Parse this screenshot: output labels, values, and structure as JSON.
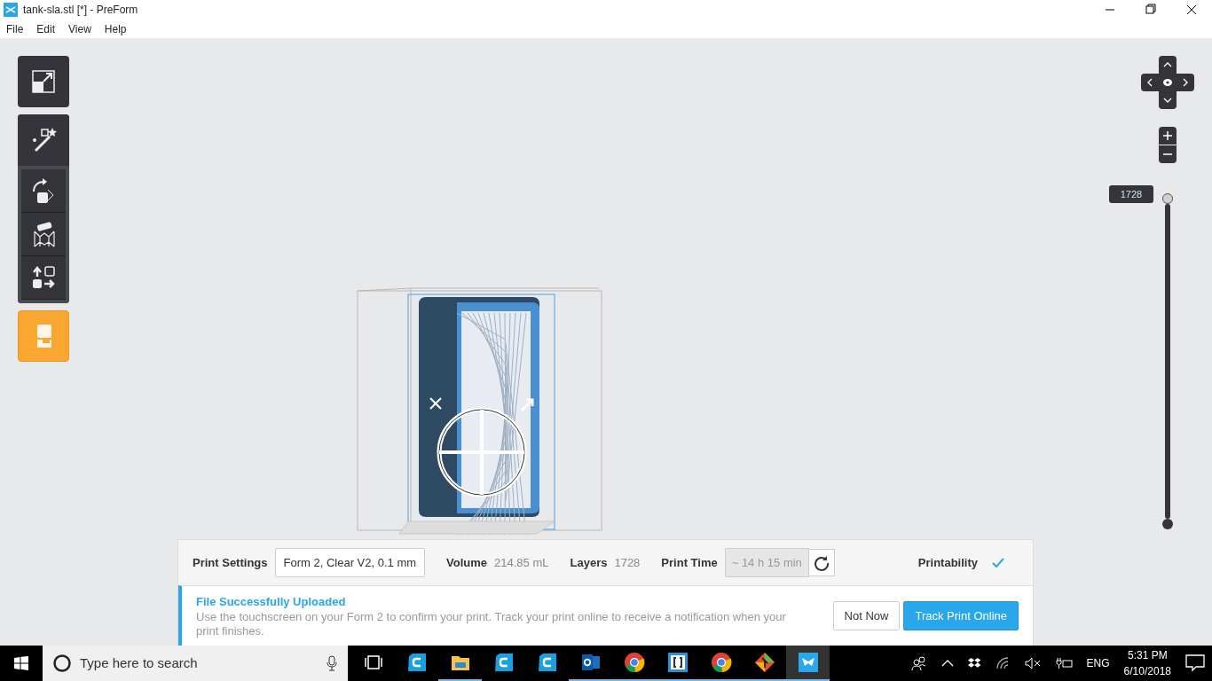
{
  "window": {
    "title": "tank-sla.stl [*] - PreForm"
  },
  "menu": [
    "File",
    "Edit",
    "View",
    "Help"
  ],
  "tool_groups": [
    {
      "tools": [
        {
          "kind": "fit",
          "selected": false
        }
      ]
    },
    {
      "tools": [
        {
          "kind": "wand",
          "selected": false
        }
      ],
      "subtools": [
        {
          "kind": "orient",
          "selected": false
        },
        {
          "kind": "supports",
          "selected": false
        },
        {
          "kind": "layout",
          "selected": false
        }
      ]
    },
    {
      "tools": [
        {
          "kind": "job",
          "selected": true
        }
      ]
    }
  ],
  "layer_slider": {
    "label": "1728",
    "level": 1
  },
  "print_bar": {
    "settings_label": "Print Settings",
    "settings_value": "Form 2, Clear V2, 0.1 mm",
    "volume_label": "Volume",
    "volume_value": "214.85 mL",
    "layers_label": "Layers",
    "layers_value": "1728",
    "time_label": "Print Time",
    "time_value": "~ 14 h 15 min",
    "time_disabled": true,
    "printability_label": "Printability",
    "printable": true
  },
  "notification": {
    "title": "File Successfully Uploaded",
    "message": "Use the touchscreen on your Form 2 to confirm your print. Track your print online to receive a notification when your print finishes.",
    "buttons": [
      {
        "label": "Not Now",
        "kind": "secondary"
      },
      {
        "label": "Track Print Online",
        "kind": "primary"
      }
    ]
  },
  "taskbar": {
    "search_placeholder": "Type here to search",
    "apps": [
      {
        "kind": "taskview",
        "running": false,
        "selected": false
      },
      {
        "kind": "cura",
        "running": false,
        "selected": false
      },
      {
        "kind": "folder",
        "running": true,
        "selected": false
      },
      {
        "kind": "cura",
        "running": false,
        "selected": false
      },
      {
        "kind": "cura",
        "running": false,
        "selected": false
      },
      {
        "kind": "outlook",
        "running": true,
        "selected": false
      },
      {
        "kind": "chrome",
        "running": true,
        "selected": false
      },
      {
        "kind": "brackets",
        "running": true,
        "selected": false
      },
      {
        "kind": "chrome",
        "running": true,
        "selected": false
      },
      {
        "kind": "git",
        "running": true,
        "selected": false
      },
      {
        "kind": "preform",
        "running": true,
        "selected": true
      }
    ],
    "language": "ENG",
    "time": "5:31 PM",
    "date": "6/10/2018"
  }
}
